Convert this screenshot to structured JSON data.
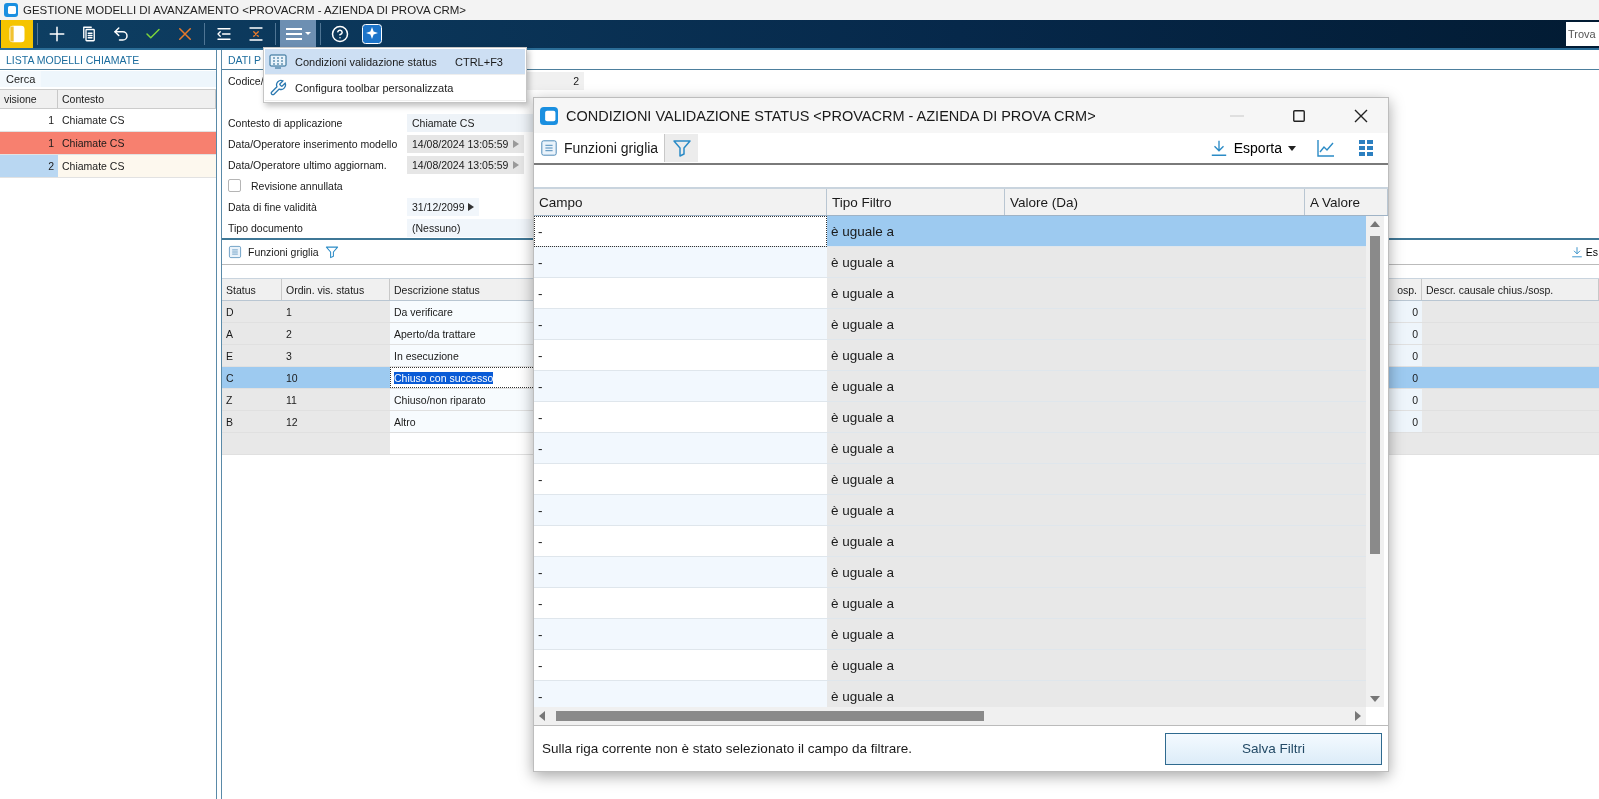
{
  "window": {
    "title": "GESTIONE MODELLI DI AVANZAMENTO <PROVACRM - AZIENDA DI PROVA CRM>"
  },
  "toolbar": [
    {
      "kind": "app"
    },
    {
      "kind": "separator"
    },
    {
      "kind": "add"
    },
    {
      "kind": "copy"
    },
    {
      "kind": "undo"
    },
    {
      "kind": "confirm"
    },
    {
      "kind": "cancel"
    },
    {
      "kind": "separator"
    },
    {
      "kind": "indent"
    },
    {
      "kind": "remove"
    },
    {
      "kind": "separator"
    },
    {
      "kind": "menu",
      "pressed": true
    },
    {
      "kind": "separator"
    },
    {
      "kind": "help"
    },
    {
      "kind": "assistant"
    }
  ],
  "find": {
    "placeholder": "Trova"
  },
  "menu": {
    "items": [
      {
        "kind": "grid",
        "label": "Condizioni validazione status",
        "shortcut": "CTRL+F3",
        "selected": true
      },
      {
        "kind": "wrench",
        "label": "Configura toolbar personalizzata",
        "selected": false
      }
    ]
  },
  "list": {
    "title": "LISTA MODELLI CHIAMATE",
    "search": "Cerca",
    "columns": [
      "visione",
      "Contesto"
    ],
    "rows": [
      {
        "revision": "1",
        "context": "Chiamate CS",
        "color": "#ffffff",
        "selected": false
      },
      {
        "revision": "1",
        "context": "Chiamate CS",
        "color": "#f7806f",
        "selected": false
      },
      {
        "revision": "2",
        "context": "Chiamate CS",
        "color": "#fdf8ee",
        "selected": true
      }
    ]
  },
  "details": {
    "title": "DATI P",
    "fields": [
      {
        "kind": "number",
        "label": "Codice/",
        "value": "2"
      },
      {
        "kind": "text",
        "label": "Contesto di applicazione",
        "value": "Chiamate CS"
      },
      {
        "kind": "stamp",
        "label": "Data/Operatore inserimento modello",
        "value": "14/08/2024 13:05:59"
      },
      {
        "kind": "stamp",
        "label": "Data/Operatore ultimo aggiornam.",
        "value": "14/08/2024 13:05:59"
      },
      {
        "kind": "check",
        "label": "Revisione annullata",
        "checked": false
      },
      {
        "kind": "date",
        "label": "Data di fine validità",
        "value": "31/12/2099"
      },
      {
        "kind": "plain",
        "label": "Tipo documento",
        "value": "(Nessuno)"
      }
    ]
  },
  "grid": {
    "toolbar_label": "Funzioni griglia",
    "export_label": "Es",
    "columns": [
      "Status",
      "Ordin. vis. status",
      "Descrizione status",
      "osp.",
      "Descr. causale chius./sosp."
    ],
    "rows": [
      {
        "status": "D",
        "order": "1",
        "description": "Da verificare",
        "column_4": "0",
        "selected": false
      },
      {
        "status": "A",
        "order": "2",
        "description": "Aperto/da trattare",
        "column_4": "0",
        "selected": false
      },
      {
        "status": "E",
        "order": "3",
        "description": "In esecuzione",
        "column_4": "0",
        "selected": false
      },
      {
        "status": "C",
        "order": "10",
        "description": "Chiuso con successo",
        "column_4": "0",
        "selected": true
      },
      {
        "status": "Z",
        "order": "11",
        "description": "Chiuso/non riparato",
        "column_4": "0",
        "selected": false
      },
      {
        "status": "B",
        "order": "12",
        "description": "Altro",
        "column_4": "0",
        "selected": false
      }
    ]
  },
  "dialog": {
    "title": "CONDIZIONI VALIDAZIONE STATUS <PROVACRM - AZIENDA DI PROVA CRM>",
    "functions_label": "Funzioni griglia",
    "filter_pressed": true,
    "export_label": "Esporta",
    "columns": [
      "Campo",
      "Tipo Filtro",
      "Valore (Da)",
      "A Valore"
    ],
    "rows": [
      {
        "field": "-",
        "operator": "è uguale a",
        "selected": true
      },
      {
        "field": "-",
        "operator": "è uguale a",
        "selected": false
      },
      {
        "field": "-",
        "operator": "è uguale a",
        "selected": false
      },
      {
        "field": "-",
        "operator": "è uguale a",
        "selected": false
      },
      {
        "field": "-",
        "operator": "è uguale a",
        "selected": false
      },
      {
        "field": "-",
        "operator": "è uguale a",
        "selected": false
      },
      {
        "field": "-",
        "operator": "è uguale a",
        "selected": false
      },
      {
        "field": "-",
        "operator": "è uguale a",
        "selected": false
      },
      {
        "field": "-",
        "operator": "è uguale a",
        "selected": false
      },
      {
        "field": "-",
        "operator": "è uguale a",
        "selected": false
      },
      {
        "field": "-",
        "operator": "è uguale a",
        "selected": false
      },
      {
        "field": "-",
        "operator": "è uguale a",
        "selected": false
      },
      {
        "field": "-",
        "operator": "è uguale a",
        "selected": false
      },
      {
        "field": "-",
        "operator": "è uguale a",
        "selected": false
      },
      {
        "field": "-",
        "operator": "è uguale a",
        "selected": false
      },
      {
        "field": "-",
        "operator": "è uguale a",
        "selected": false
      }
    ],
    "message": "Sulla riga corrente non è stato selezionato il campo da filtrare.",
    "save_button": "Salva Filtri"
  }
}
